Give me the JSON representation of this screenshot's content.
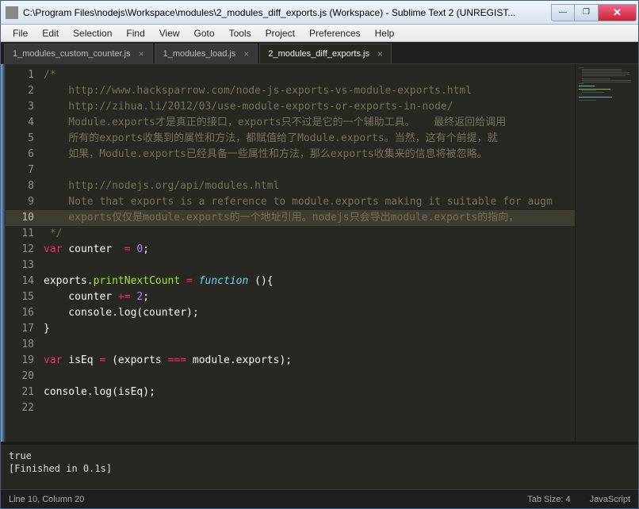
{
  "titlebar": {
    "text": "C:\\Program Files\\nodejs\\Workspace\\modules\\2_modules_diff_exports.js (Workspace) - Sublime Text 2 (UNREGIST..."
  },
  "menu": [
    "File",
    "Edit",
    "Selection",
    "Find",
    "View",
    "Goto",
    "Tools",
    "Project",
    "Preferences",
    "Help"
  ],
  "tabs": [
    {
      "label": "1_modules_custom_counter.js",
      "active": false
    },
    {
      "label": "1_modules_load.js",
      "active": false
    },
    {
      "label": "2_modules_diff_exports.js",
      "active": true
    }
  ],
  "code": {
    "lines": [
      {
        "n": 1,
        "c": "cmt",
        "t": "/*"
      },
      {
        "n": 2,
        "c": "cmt",
        "t": "    http://www.hacksparrow.com/node-js-exports-vs-module-exports.html"
      },
      {
        "n": 3,
        "c": "cmt",
        "t": "    http://zihua.li/2012/03/use-module-exports-or-exports-in-node/"
      },
      {
        "n": 4,
        "c": "cmt",
        "t": "    Module.exports才是真正的接口，exports只不过是它的一个辅助工具。   最终返回给调用"
      },
      {
        "n": 5,
        "c": "cmt",
        "t": "    所有的exports收集到的属性和方法，都赋值给了Module.exports。当然，这有个前提，就"
      },
      {
        "n": 6,
        "c": "cmt",
        "t": "    如果，Module.exports已经具备一些属性和方法，那么exports收集来的信息将被忽略。"
      },
      {
        "n": 7,
        "c": "cmt",
        "t": ""
      },
      {
        "n": 8,
        "c": "cmt",
        "t": "    http://nodejs.org/api/modules.html"
      },
      {
        "n": 9,
        "c": "cmt",
        "t": "    Note that exports is a reference to module.exports making it suitable for augm"
      },
      {
        "n": 10,
        "c": "cmt",
        "t": "    exports仅仅是module.exports的一个地址引用。nodejs只会导出module.exports的指向，",
        "cur": true
      },
      {
        "n": 11,
        "c": "cmt",
        "t": " */"
      },
      {
        "n": 12,
        "c": "code",
        "seg": [
          [
            "st",
            "var "
          ],
          [
            "pn",
            "counter  "
          ],
          [
            "op",
            "= "
          ],
          [
            "num",
            "0"
          ],
          [
            "pn",
            ";"
          ]
        ]
      },
      {
        "n": 13,
        "c": "code",
        "seg": []
      },
      {
        "n": 14,
        "c": "code",
        "seg": [
          [
            "pn",
            "exports"
          ],
          [
            "pn",
            "."
          ],
          [
            "fn",
            "printNextCount"
          ],
          [
            "pn",
            " "
          ],
          [
            "op",
            "= "
          ],
          [
            "kw",
            "function "
          ],
          [
            "pn",
            "(){"
          ]
        ]
      },
      {
        "n": 15,
        "c": "code",
        "seg": [
          [
            "pn",
            "    counter "
          ],
          [
            "op",
            "+= "
          ],
          [
            "num",
            "2"
          ],
          [
            "pn",
            ";"
          ]
        ]
      },
      {
        "n": 16,
        "c": "code",
        "seg": [
          [
            "pn",
            "    console"
          ],
          [
            "pn",
            "."
          ],
          [
            "pn",
            "log"
          ],
          [
            "pn",
            "(counter);"
          ]
        ]
      },
      {
        "n": 17,
        "c": "code",
        "seg": [
          [
            "pn",
            "}"
          ]
        ]
      },
      {
        "n": 18,
        "c": "code",
        "seg": []
      },
      {
        "n": 19,
        "c": "code",
        "seg": [
          [
            "st",
            "var "
          ],
          [
            "pn",
            "isEq "
          ],
          [
            "op",
            "= "
          ],
          [
            "pn",
            "(exports "
          ],
          [
            "op",
            "=== "
          ],
          [
            "pn",
            "module"
          ],
          [
            "pn",
            "."
          ],
          [
            "pn",
            "exports);"
          ]
        ]
      },
      {
        "n": 20,
        "c": "code",
        "seg": []
      },
      {
        "n": 21,
        "c": "code",
        "seg": [
          [
            "pn",
            "console"
          ],
          [
            "pn",
            "."
          ],
          [
            "pn",
            "log"
          ],
          [
            "pn",
            "(isEq);"
          ]
        ]
      },
      {
        "n": 22,
        "c": "code",
        "seg": []
      }
    ]
  },
  "console": {
    "line1": "true",
    "line2": "[Finished in 0.1s]"
  },
  "status": {
    "left": "Line 10, Column 20",
    "tab": "Tab Size: 4",
    "lang": "JavaScript"
  }
}
